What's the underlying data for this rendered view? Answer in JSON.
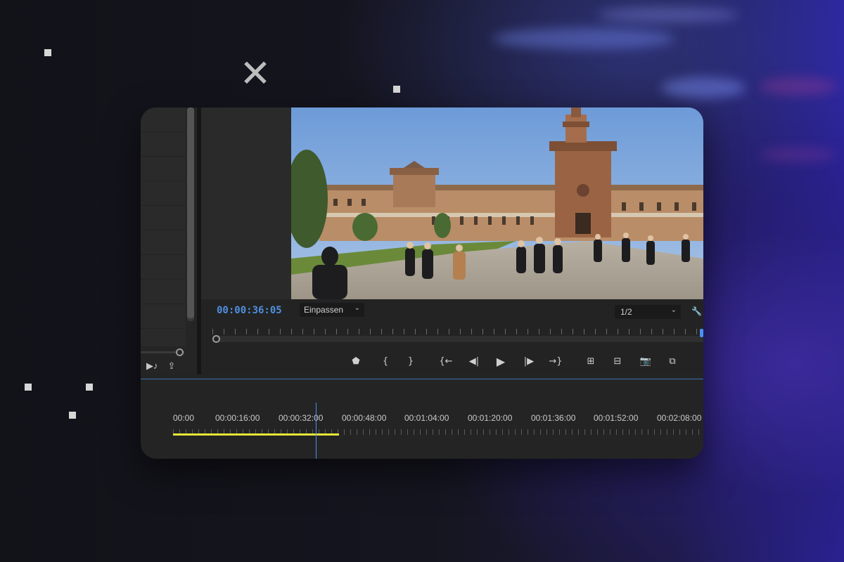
{
  "monitor": {
    "timecode": "00:00:36:05",
    "fit_select": "Einpassen",
    "resolution_select": "1/2"
  },
  "timeline": {
    "labels": [
      "00:00",
      "00:00:16:00",
      "00:00:32:00",
      "00:00:48:00",
      "00:01:04:00",
      "00:01:20:00",
      "00:01:36:00",
      "00:01:52:00",
      "00:02:08:00"
    ]
  },
  "colors": {
    "timecode": "#4f8fe0",
    "playhead": "#4b8ff0",
    "work_area": "#e6e63a",
    "cursor_highlight": "#d6d628"
  },
  "icons": {
    "decor": "close-icon",
    "transport": [
      "marker-icon",
      "mark-in-icon",
      "mark-out-icon",
      "go-to-in-icon",
      "step-back-icon",
      "play-icon",
      "step-forward-icon",
      "go-to-out-icon",
      "insert-icon",
      "overwrite-icon",
      "export-frame-icon",
      "compare-icon"
    ]
  }
}
